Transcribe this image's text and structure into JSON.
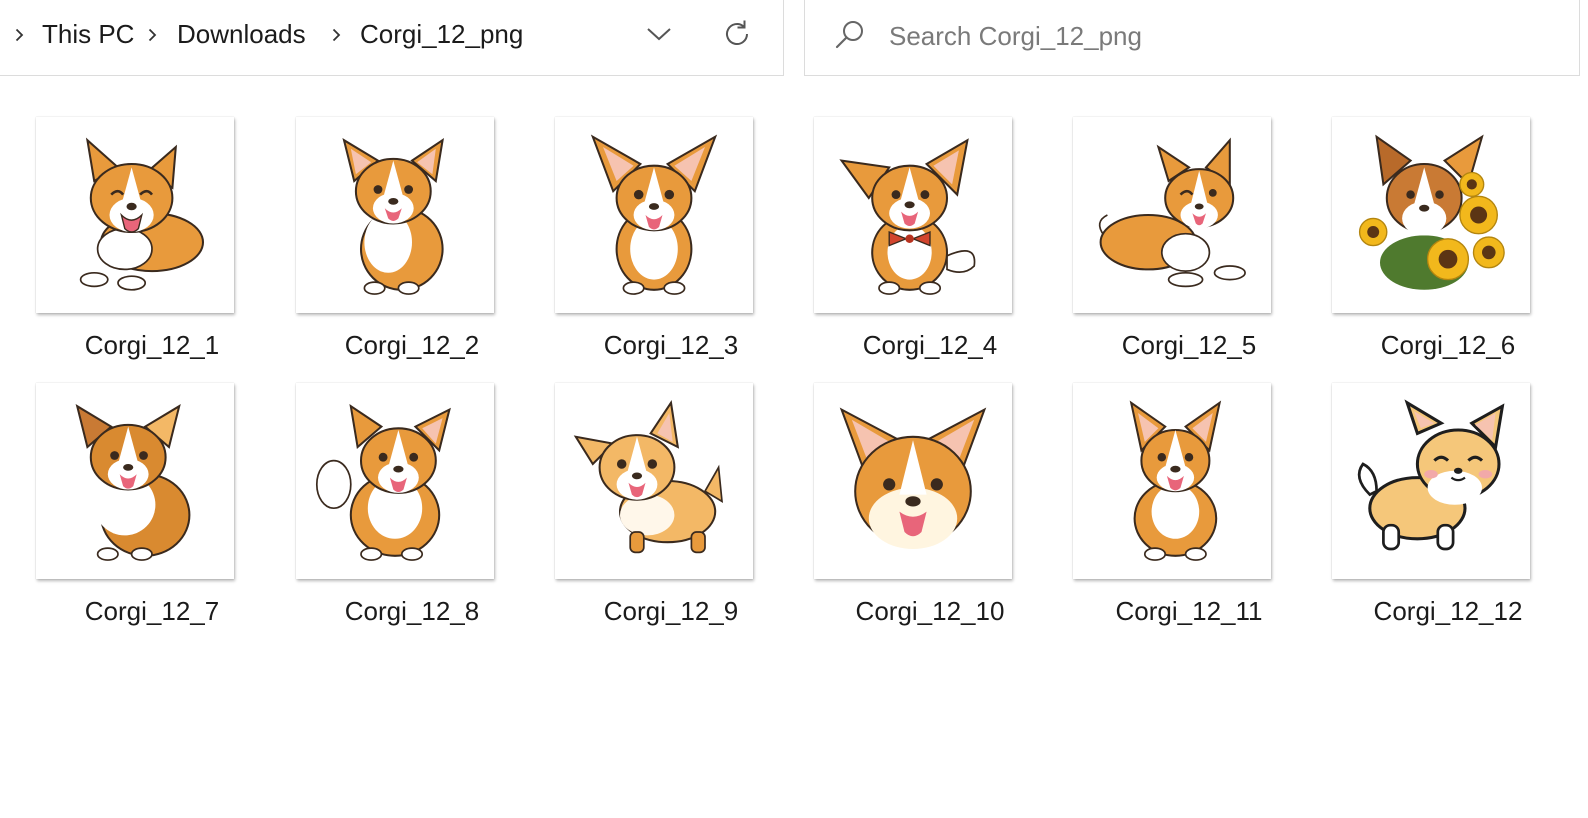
{
  "breadcrumb": {
    "items": [
      "This PC",
      "Downloads",
      "Corgi_12_png"
    ]
  },
  "search": {
    "placeholder": "Search Corgi_12_png"
  },
  "icons": {
    "breadcrumb_separator": "chevron-right-icon",
    "history_dropdown": "chevron-down-icon",
    "refresh": "refresh-icon",
    "search": "search-icon"
  },
  "colors": {
    "fur": "#e89a3c",
    "fur_light": "#f3b866",
    "ear_inner": "#f6c3b0",
    "tongue": "#e8657a",
    "outline": "#3a2a1e",
    "sunflower": "#f2b81c",
    "leaf": "#4f7a2e"
  },
  "files": [
    {
      "name": "Corgi_12_1",
      "pose": "lying-happy"
    },
    {
      "name": "Corgi_12_2",
      "pose": "sitting"
    },
    {
      "name": "Corgi_12_3",
      "pose": "sitting-front"
    },
    {
      "name": "Corgi_12_4",
      "pose": "bowtie"
    },
    {
      "name": "Corgi_12_5",
      "pose": "lying-wink"
    },
    {
      "name": "Corgi_12_6",
      "pose": "sunflowers"
    },
    {
      "name": "Corgi_12_7",
      "pose": "sitting-fluffy"
    },
    {
      "name": "Corgi_12_8",
      "pose": "sitting-tail"
    },
    {
      "name": "Corgi_12_9",
      "pose": "standing"
    },
    {
      "name": "Corgi_12_10",
      "pose": "head"
    },
    {
      "name": "Corgi_12_11",
      "pose": "sitting-tall"
    },
    {
      "name": "Corgi_12_12",
      "pose": "cartoon-walking"
    }
  ]
}
